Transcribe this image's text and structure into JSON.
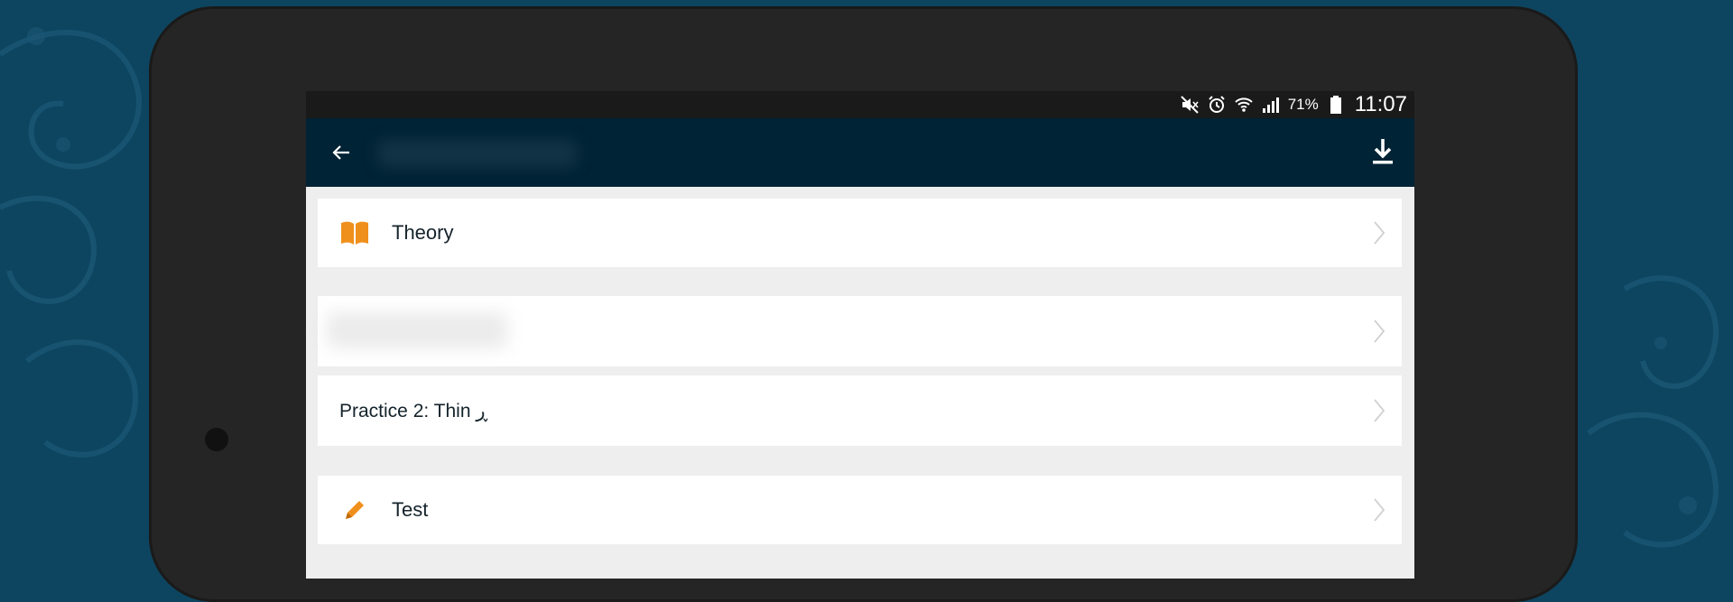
{
  "status_bar": {
    "battery_percent": "71%",
    "time": "11:07",
    "icons": [
      "mute-icon",
      "alarm-icon",
      "wifi-icon",
      "signal-icon",
      "battery-icon"
    ]
  },
  "app_bar": {
    "back_icon": "arrow-left-icon",
    "download_icon": "download-icon"
  },
  "list": [
    {
      "label": "Theory",
      "icon": "book-icon",
      "icon_color": "#f0901c"
    },
    {
      "label": ""
    },
    {
      "label": "Practice 2: Thin ڕ"
    },
    {
      "label": "Test",
      "icon": "pencil-icon",
      "icon_color": "#f0901c"
    }
  ],
  "colors": {
    "background": "#0d4560",
    "app_bar": "#002335",
    "accent": "#f0901c"
  }
}
